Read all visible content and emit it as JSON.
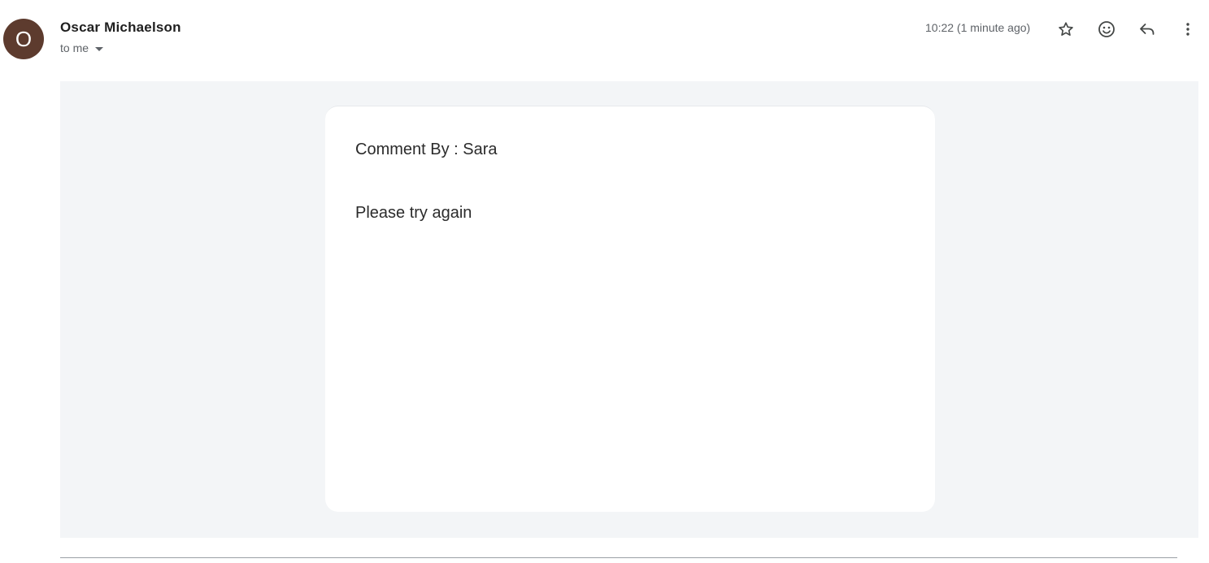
{
  "sender": {
    "avatar_letter": "O",
    "avatar_color": "#5d3b2e",
    "name": "Oscar Michaelson",
    "recipient_label": "to me"
  },
  "header": {
    "timestamp": "10:22 (1 minute ago)",
    "actions": [
      "star-icon",
      "emoji-icon",
      "reply-icon",
      "more-vert-icon"
    ]
  },
  "message": {
    "comment_by": "Comment By : Sara",
    "comment_text": "Please try again"
  },
  "colors": {
    "body_background": "#f3f5f7",
    "card_background": "#ffffff",
    "text_primary": "#1f1f1f",
    "text_secondary": "#5f6368"
  }
}
